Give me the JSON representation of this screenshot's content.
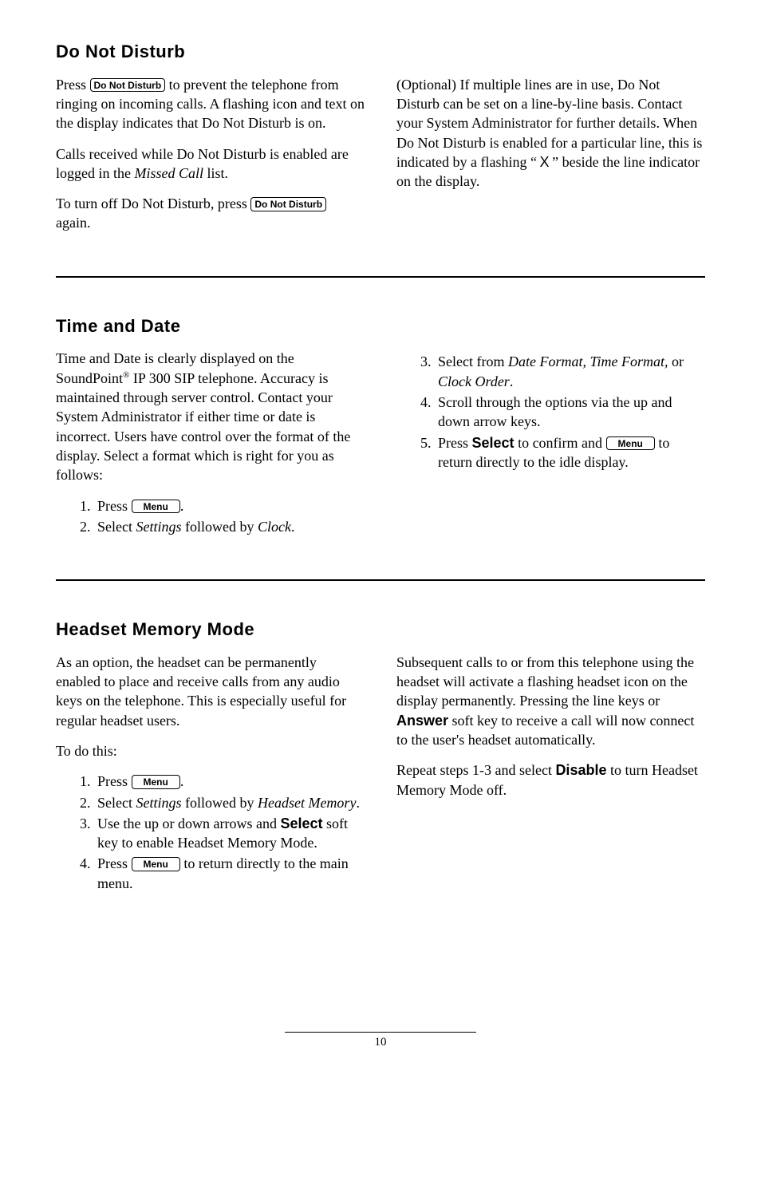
{
  "dnd": {
    "heading": "Do Not Disturb",
    "p1_a": "Press ",
    "key_dnd": "Do Not Disturb",
    "p1_b": " to prevent the telephone from ringing on incoming calls.  A flashing icon and text on the display indicates that Do Not Disturb is on.",
    "p2_a": "Calls received while Do Not Disturb is enabled are logged in the ",
    "p2_em": "Missed Call",
    "p2_b": " list.",
    "p3_a": "To turn off Do Not Disturb, press ",
    "p3_b": " again.",
    "p4_a": "(Optional) If multiple lines are in use, Do Not Disturb can be set on a line-by-line basis.  Contact your System Administrator for further details.  When Do Not Disturb is enabled for a particular line, this is indicated by a flashing “ ",
    "p4_x": "X",
    "p4_b": " ” beside the line indicator on the display."
  },
  "td": {
    "heading": "Time and Date",
    "p1_a": "Time and Date is clearly displayed on the SoundPoint",
    "p1_sup": "®",
    "p1_b": " IP 300 SIP telephone.  Accuracy is maintained through server control.  Contact your System Administrator if either time or date is incorrect.  Users have control over the format of the display.  Select a format which is right for you as follows:",
    "li1_a": "Press ",
    "key_menu": "Menu",
    "li1_b": ".",
    "li2_a": "Select ",
    "li2_em1": "Settings",
    "li2_mid": " followed by ",
    "li2_em2": "Clock",
    "li2_b": ".",
    "li3_a": "Select from ",
    "li3_em1": "Date Format, Time Format,",
    "li3_mid": " or ",
    "li3_em2": "Clock Order",
    "li3_b": ".",
    "li4": "Scroll through the options via the up and down arrow keys.",
    "li5_a": "Press ",
    "li5_key": "Select",
    "li5_mid": " to confirm and ",
    "li5_b": " to return directly to the idle display."
  },
  "hm": {
    "heading": "Headset Memory Mode",
    "p1": "As an option, the headset can be permanently enabled to place and receive calls from any audio keys on the telephone.  This is especially useful for regular headset users.",
    "p2": "To do this:",
    "li1_a": "Press ",
    "li1_b": ".",
    "li2_a": "Select ",
    "li2_em1": "Settings",
    "li2_mid": " followed by ",
    "li2_em2": "Headset Memory",
    "li2_b": ".",
    "li3_a": "Use the up or down arrows and ",
    "li3_key": "Select",
    "li3_b": " soft key to enable Headset Memory Mode.",
    "li4_a": "Press ",
    "li4_b": " to return directly to the main menu.",
    "p3_a": "Subsequent calls to or from this telephone using the headset will activate a flashing headset icon on the display permanently. Pressing the line keys or ",
    "p3_key": "Answer",
    "p3_b": " soft key to receive a call will now connect to the user's headset automatically.",
    "p4_a": "Repeat steps 1-3 and select ",
    "p4_key": "Disable",
    "p4_b": " to turn Headset Memory Mode off."
  },
  "page": "10"
}
